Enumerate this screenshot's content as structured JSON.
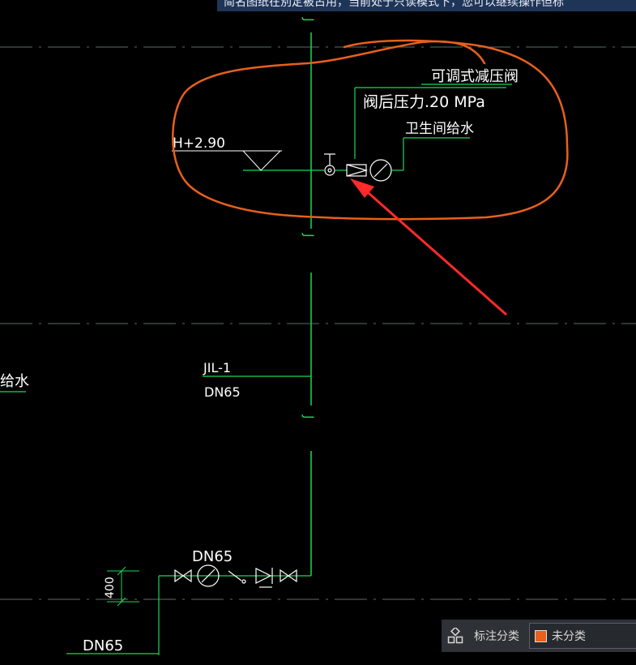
{
  "banner": {
    "text": "简名图纸在別定被占用，当前处于只读模式下，您可以继续操作但标"
  },
  "drawing": {
    "pipe_code": "J",
    "annotation_pressure_valve": "可调式减压阀",
    "annotation_post_pressure": "阀后压力.20 MPa",
    "annotation_bathroom_supply": "卫生间给水",
    "elevation_label": "H+2.90",
    "left_edge_label": "给水",
    "riser_id": "JIL-1",
    "riser_dn": "DN65",
    "bottom_dn_top": "DN65",
    "bottom_dn_left": "DN65",
    "dimension_400": "400",
    "colors": {
      "line": "#19d85a",
      "axis": "#5b6b6b",
      "text": "#ffffff",
      "markup": "#e8601c",
      "arrow": "#ff2a2a"
    }
  },
  "status_bar": {
    "grid_icon": "grid-icon",
    "label": "标注分类",
    "selected_option": "未分类",
    "swatch_color": "#e8601c"
  }
}
